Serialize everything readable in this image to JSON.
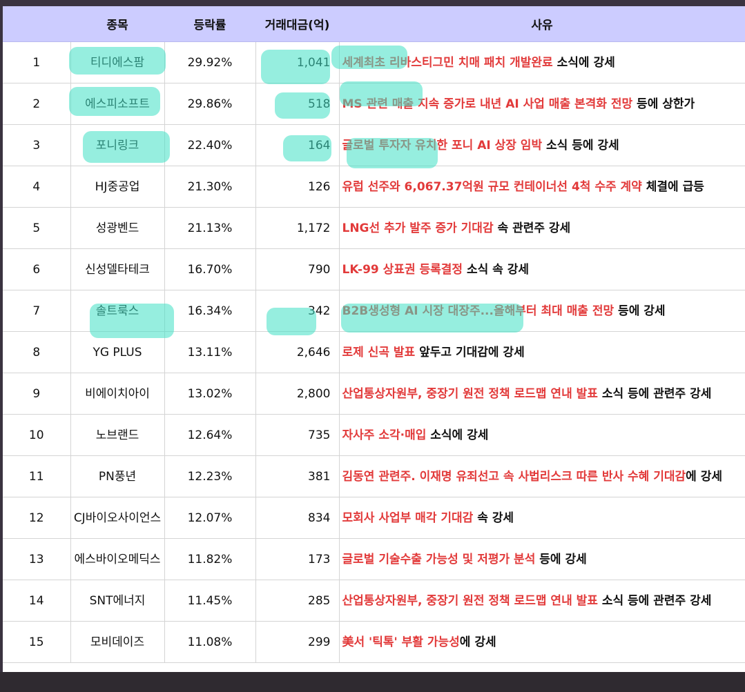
{
  "headers": {
    "rank": "",
    "name": "종목",
    "rate": "등락률",
    "volume": "거래대금(억)",
    "reason": "사유"
  },
  "rows": [
    {
      "rank": "1",
      "name": "티디에스팜",
      "rate": "29.92%",
      "volume": "1,041",
      "reason_red": "세계최초 리바스티그민 치매 패치 개발완료",
      "reason_black": " 소식에 강세"
    },
    {
      "rank": "2",
      "name": "에스피소프트",
      "rate": "29.86%",
      "volume": "518",
      "reason_red": "MS 관련 매출 지속 증가로 내년 AI 사업 매출 본격화 전망",
      "reason_black": " 등에 상한가"
    },
    {
      "rank": "3",
      "name": "포니링크",
      "rate": "22.40%",
      "volume": "164",
      "reason_red": "글로벌 투자자 유치한 포니 AI 상장 임박",
      "reason_black": " 소식 등에 강세"
    },
    {
      "rank": "4",
      "name": "HJ중공업",
      "rate": "21.30%",
      "volume": "126",
      "reason_red": "유럽 선주와 6,067.37억원 규모 컨테이너선 4척 수주 계약",
      "reason_black": " 체결에 급등"
    },
    {
      "rank": "5",
      "name": "성광벤드",
      "rate": "21.13%",
      "volume": "1,172",
      "reason_red": "LNG선 추가 발주 증가 기대감",
      "reason_black": " 속 관련주 강세"
    },
    {
      "rank": "6",
      "name": "신성델타테크",
      "rate": "16.70%",
      "volume": "790",
      "reason_red": "LK-99 상표권 등록결정",
      "reason_black": " 소식 속 강세"
    },
    {
      "rank": "7",
      "name": "솔트룩스",
      "rate": "16.34%",
      "volume": "342",
      "reason_red": "B2B생성형 AI 시장 대장주...올해부터 최대 매출 전망",
      "reason_black": " 등에 강세"
    },
    {
      "rank": "8",
      "name": "YG PLUS",
      "rate": "13.11%",
      "volume": "2,646",
      "reason_red": "로제 신곡 발표",
      "reason_black": " 앞두고 기대감에 강세"
    },
    {
      "rank": "9",
      "name": "비에이치아이",
      "rate": "13.02%",
      "volume": "2,800",
      "reason_red": "산업통상자원부, 중장기 원전 정책 로드맵 연내 발표",
      "reason_black": " 소식 등에 관련주 강세"
    },
    {
      "rank": "10",
      "name": "노브랜드",
      "rate": "12.64%",
      "volume": "735",
      "reason_red": "자사주 소각·매입",
      "reason_black": " 소식에 강세"
    },
    {
      "rank": "11",
      "name": "PN풍년",
      "rate": "12.23%",
      "volume": "381",
      "reason_red": "김동연 관련주. 이재명 유죄선고 속 사법리스크 따른 반사 수혜 기대감",
      "reason_black": "에 강세"
    },
    {
      "rank": "12",
      "name": "CJ바이오사이언스",
      "rate": "12.07%",
      "volume": "834",
      "reason_red": "모회사 사업부 매각 기대감",
      "reason_black": " 속 강세"
    },
    {
      "rank": "13",
      "name": "에스바이오메딕스",
      "rate": "11.82%",
      "volume": "173",
      "reason_red": "글로벌 기술수출 가능성 및 저평가 분석",
      "reason_black": " 등에 강세"
    },
    {
      "rank": "14",
      "name": "SNT에너지",
      "rate": "11.45%",
      "volume": "285",
      "reason_red": "산업통상자원부, 중장기 원전 정책 로드맵 연내 발표",
      "reason_black": " 소식 등에 관련주 강세"
    },
    {
      "rank": "15",
      "name": "모비데이즈",
      "rate": "11.08%",
      "volume": "299",
      "reason_red": "美서 '틱톡' 부활 가능성",
      "reason_black": "에 강세"
    }
  ],
  "colors": {
    "header_bg": "#ccccff",
    "reason_highlight": "#e23a3a",
    "marker": "#40e0c4"
  }
}
